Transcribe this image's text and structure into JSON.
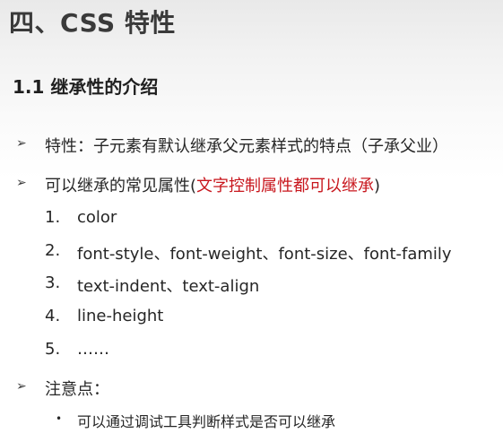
{
  "slide": {
    "title": "四、CSS 特性",
    "subtitle": "1.1 继承性的介绍",
    "bullets": [
      {
        "arrow": "➢",
        "text": "特性：子元素有默认继承父元素样式的特点（子承父业）"
      },
      {
        "arrow": "➢",
        "prefix": "可以继承的常见属性(",
        "highlight": "文字控制属性都可以继承",
        "suffix": ")"
      }
    ],
    "list": [
      {
        "num": "1.",
        "text": "color"
      },
      {
        "num": "2.",
        "text": "font-style、font-weight、font-size、font-family"
      },
      {
        "num": "3.",
        "text": "text-indent、text-align"
      },
      {
        "num": "4.",
        "text": "line-height"
      },
      {
        "num": "5.",
        "text": "……"
      }
    ],
    "note": {
      "arrow": "➢",
      "label": "注意点："
    },
    "note_items": [
      {
        "dot": "•",
        "text": "可以通过调试工具判断样式是否可以继承"
      }
    ],
    "colors": {
      "highlight": "#c8161d",
      "text": "#262626"
    }
  }
}
